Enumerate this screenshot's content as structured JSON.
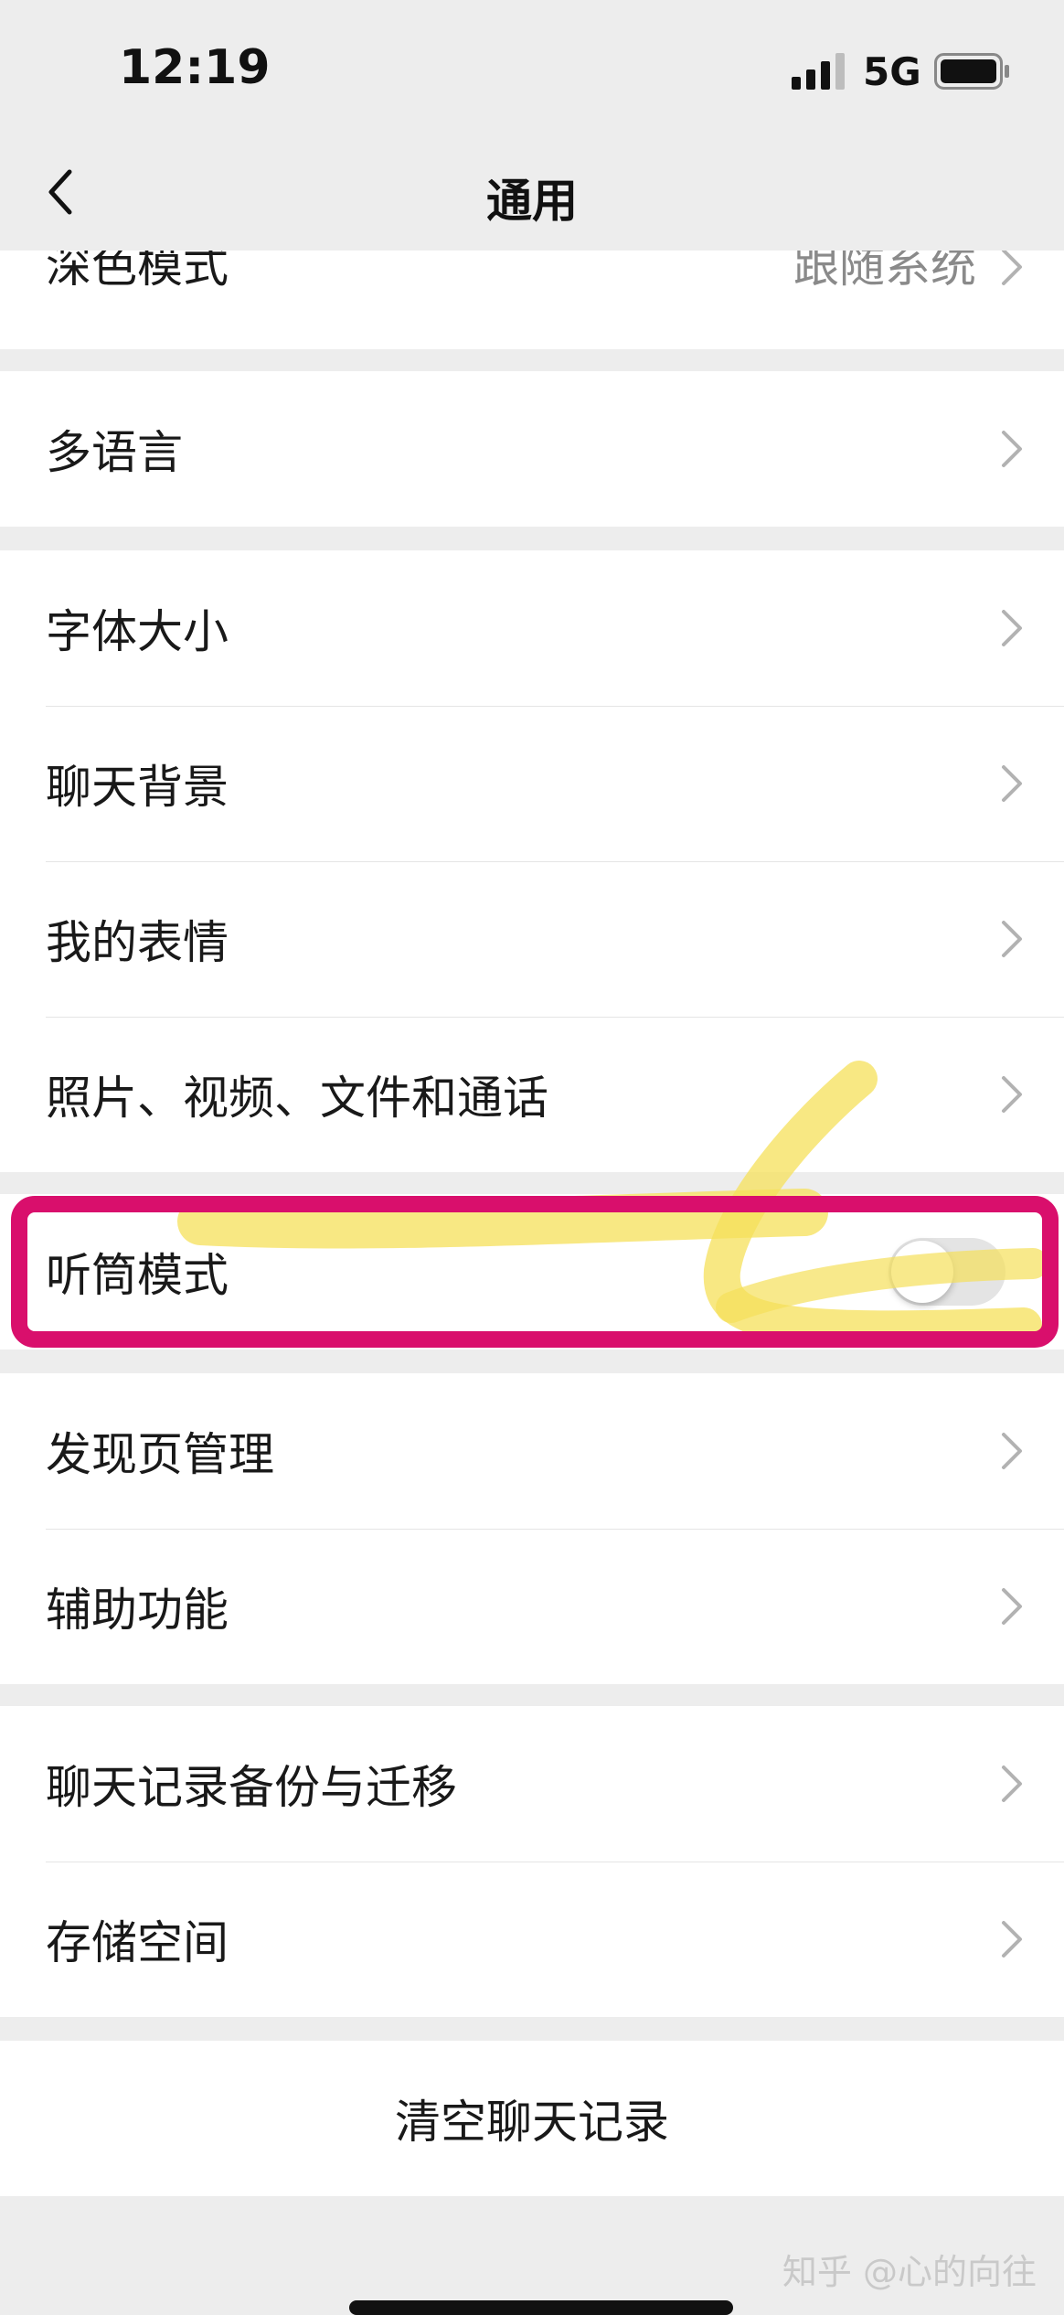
{
  "status_bar": {
    "time": "12:19",
    "network": "5G"
  },
  "nav": {
    "title": "通用",
    "back_icon": "chevron-left-icon"
  },
  "groups": [
    {
      "items": [
        {
          "label": "深色模式",
          "value": "跟随系统"
        }
      ]
    },
    {
      "items": [
        {
          "label": "多语言"
        }
      ]
    },
    {
      "items": [
        {
          "label": "字体大小"
        },
        {
          "label": "聊天背景"
        },
        {
          "label": "我的表情"
        },
        {
          "label": "照片、视频、文件和通话"
        }
      ]
    },
    {
      "items": [
        {
          "label": "听筒模式",
          "toggle_on": false
        }
      ]
    },
    {
      "items": [
        {
          "label": "发现页管理"
        },
        {
          "label": "辅助功能"
        }
      ]
    },
    {
      "items": [
        {
          "label": "聊天记录备份与迁移"
        },
        {
          "label": "存储空间"
        }
      ]
    },
    {
      "items": [
        {
          "label": "清空聊天记录"
        }
      ]
    }
  ],
  "annotations": {
    "highlight_color": "#d90f6c",
    "scribble_color": "#f5e05a"
  },
  "watermark": "知乎 @心的向往"
}
